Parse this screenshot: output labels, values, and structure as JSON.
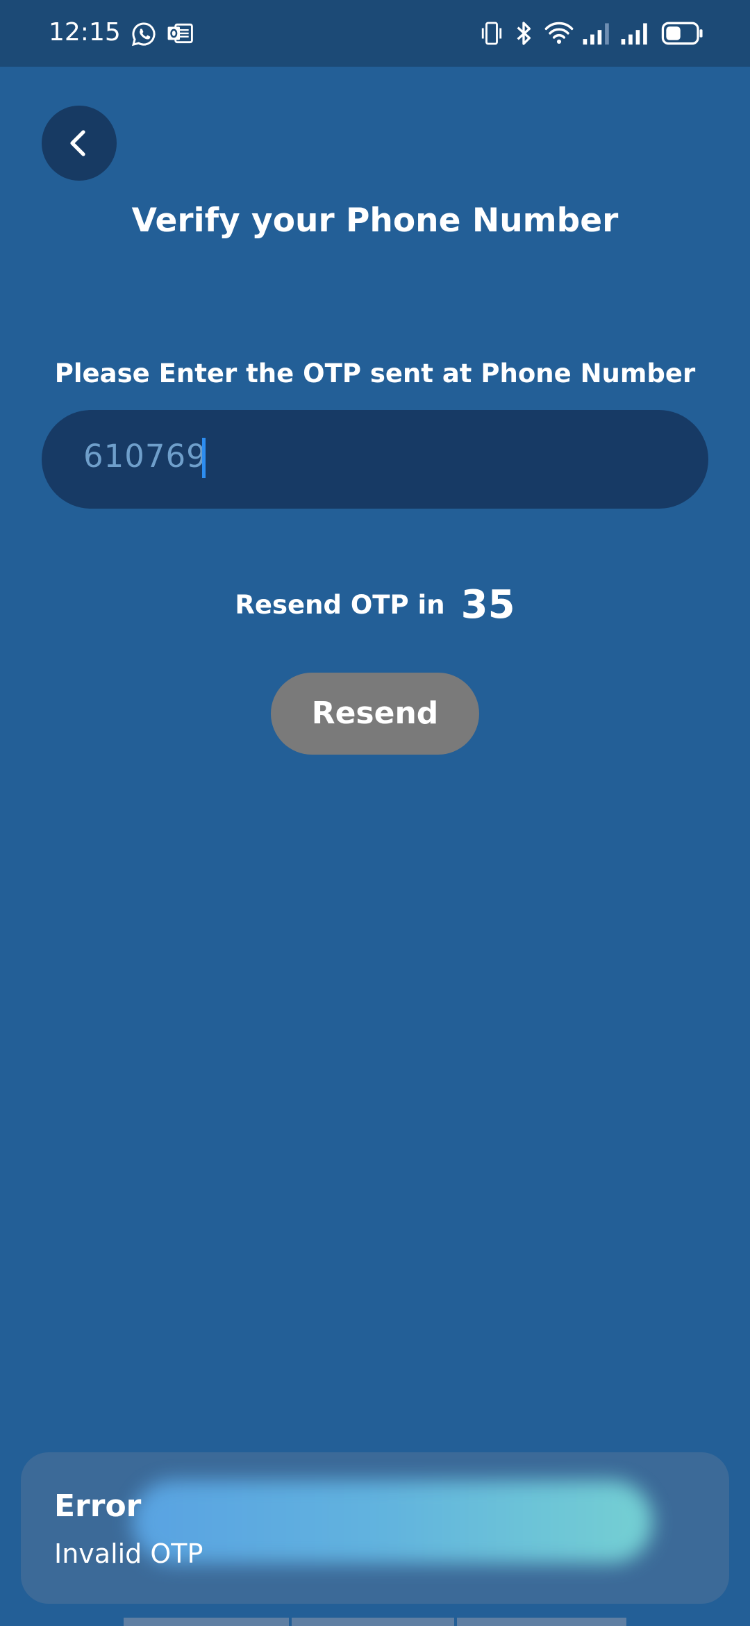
{
  "status_bar": {
    "time": "12:15",
    "left_icons": [
      "whatsapp-icon",
      "outlook-icon"
    ],
    "right_icons": [
      "vibrate-icon",
      "bluetooth-icon",
      "wifi-icon",
      "signal-icon",
      "signal-icon",
      "battery-icon"
    ],
    "battery_level": 0.5
  },
  "header": {
    "back_icon": "chevron-left-icon",
    "title": "Verify your Phone Number"
  },
  "otp": {
    "label": "Please Enter the OTP sent at Phone Number",
    "value": "610769"
  },
  "resend": {
    "text": "Resend OTP in",
    "countdown": "35",
    "button_label": "Resend"
  },
  "snackbar": {
    "title": "Error",
    "message": "Invalid OTP"
  },
  "colors": {
    "background": "#235f97",
    "status_bar": "#1c4a76",
    "input_bg": "#173a65",
    "button_disabled": "#7a7a7a",
    "caret": "#2d8df0"
  }
}
